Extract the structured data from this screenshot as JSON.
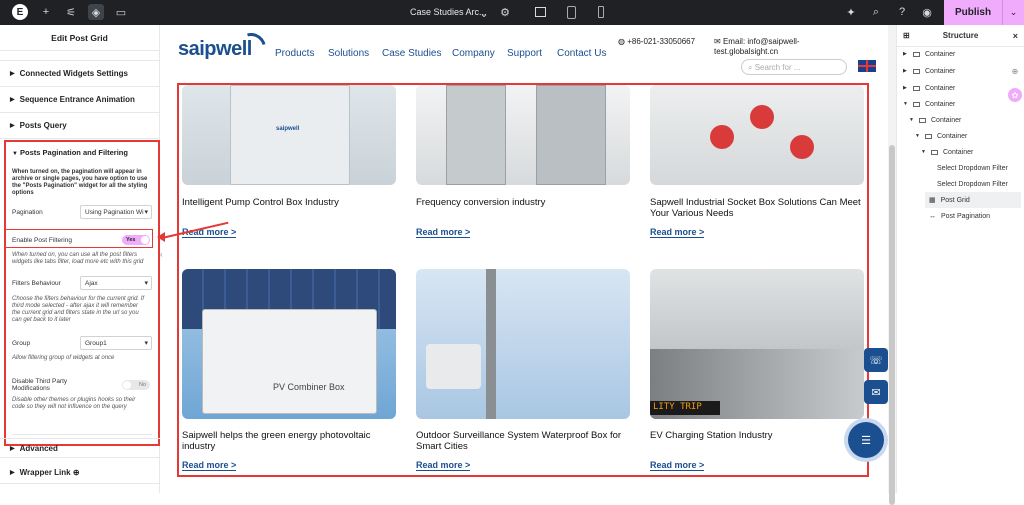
{
  "topbar": {
    "add_icon": "+",
    "sliders_icon": "⚟",
    "layers_icon": "◈",
    "comment_icon": "▭",
    "doc_title": "Case Studies Arc...",
    "chevron": "⌄",
    "publish_label": "Publish",
    "publish_more": "⌄"
  },
  "left_panel": {
    "title": "Edit Post Grid",
    "sections": [
      {
        "label": "Connected Widgets Settings"
      },
      {
        "label": "Sequence Entrance Animation"
      },
      {
        "label": "Posts Query"
      }
    ],
    "open_section": {
      "title": "Posts Pagination and Filtering",
      "note1": "When turned on, the pagination will appear in archive or single pages, you have option to use the \"Posts Pagination\" widget for all the styling options",
      "pagination_label": "Pagination",
      "pagination_value": "Using Pagination Wi",
      "enable_filtering_label": "Enable Post Filtering",
      "enable_filtering_value": "Yes",
      "note2": "When turned on, you can use all the post filters widgets like tabs filter, load more etc with this grid",
      "filters_behaviour_label": "Filters Behaviour",
      "filters_behaviour_value": "Ajax",
      "note3": "Choose the filters behaviour for the current grid. If third mode selected - after ajax it will remember the current grid and filters state in the url so you can get back to it later",
      "group_label": "Group",
      "group_value": "Group1",
      "note4": "Allow filtering group of widgets at once",
      "disable_themes_label": "Disable Third Party Modifications",
      "disable_themes_value": "No",
      "note5": "Disable other themes or plugins hooks so their code so they will not influence on the query"
    },
    "bottom_sections": [
      {
        "label": "Advanced"
      },
      {
        "label": "Wrapper Link ⊕"
      }
    ]
  },
  "site": {
    "logo": "saipwell",
    "nav": [
      "Products",
      "Solutions",
      "Case Studies",
      "Company",
      "Support",
      "Contact Us"
    ],
    "phone": "+86-021-33050667",
    "email_label": "Email:",
    "email": "info@saipwell-test.globalsight.cn",
    "search_placeholder": "Search for ...",
    "cards": [
      {
        "title": "Intelligent Pump Control Box Industry",
        "read_more": "Read more >"
      },
      {
        "title": "Frequency conversion industry",
        "read_more": "Read more >"
      },
      {
        "title": "Sapwell Industrial Socket Box Solutions Can Meet Your Various Needs",
        "read_more": "Read more >"
      },
      {
        "title": "Saipwell helps the green energy photovoltaic industry",
        "read_more": "Read more >"
      },
      {
        "title": "Outdoor Surveillance System Waterproof Box for Smart Cities",
        "read_more": "Read more >"
      },
      {
        "title": "EV Charging Station Industry",
        "read_more": "Read more >"
      }
    ],
    "pv_label": "PV Combiner Box",
    "banner_text": "LITY TRIP",
    "cabinet_brand": "saipwell"
  },
  "structure": {
    "title": "Structure",
    "items": [
      {
        "label": "Container"
      },
      {
        "label": "Container"
      },
      {
        "label": "Container"
      },
      {
        "label": "Container"
      },
      {
        "label": "Container"
      },
      {
        "label": "Container"
      },
      {
        "label": "Container"
      },
      {
        "label": "Select Dropdown Filter"
      },
      {
        "label": "Select Dropdown Filter"
      },
      {
        "label": "Post Grid"
      },
      {
        "label": "Post Pagination"
      }
    ]
  },
  "colors": {
    "accent": "#f0abfc",
    "brand": "#1b4f8f",
    "highlight": "#e53935"
  }
}
